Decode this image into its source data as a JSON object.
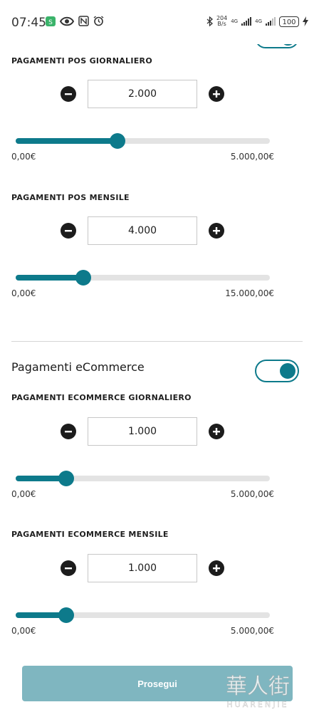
{
  "status_bar": {
    "time": "07:45",
    "speed_top": "204",
    "speed_unit": "B/s",
    "net1": "4G",
    "net2": "4G",
    "battery": "100"
  },
  "colors": {
    "accent": "#0d7a8b",
    "track": "#e3e3e3",
    "cta_bg": "#7fb6c0"
  },
  "pos": {
    "daily": {
      "label": "PAGAMENTI POS GIORNALIERO",
      "value": "2.000",
      "min_label": "0,00€",
      "max_label": "5.000,00€",
      "fraction": 0.4
    },
    "monthly": {
      "label": "PAGAMENTI POS MENSILE",
      "value": "4.000",
      "min_label": "0,00€",
      "max_label": "15.000,00€",
      "fraction": 0.267
    }
  },
  "ecommerce": {
    "heading": "Pagamenti eCommerce",
    "toggle_on": true,
    "daily": {
      "label": "PAGAMENTI ECOMMERCE GIORNALIERO",
      "value": "1.000",
      "min_label": "0,00€",
      "max_label": "5.000,00€",
      "fraction": 0.2
    },
    "monthly": {
      "label": "PAGAMENTI ECOMMERCE MENSILE",
      "value": "1.000",
      "min_label": "0,00€",
      "max_label": "5.000,00€",
      "fraction": 0.2
    }
  },
  "cta": {
    "label": "Prosegui"
  },
  "watermark": {
    "text_top": "華人街",
    "text_bottom": "HUARENJIE"
  }
}
